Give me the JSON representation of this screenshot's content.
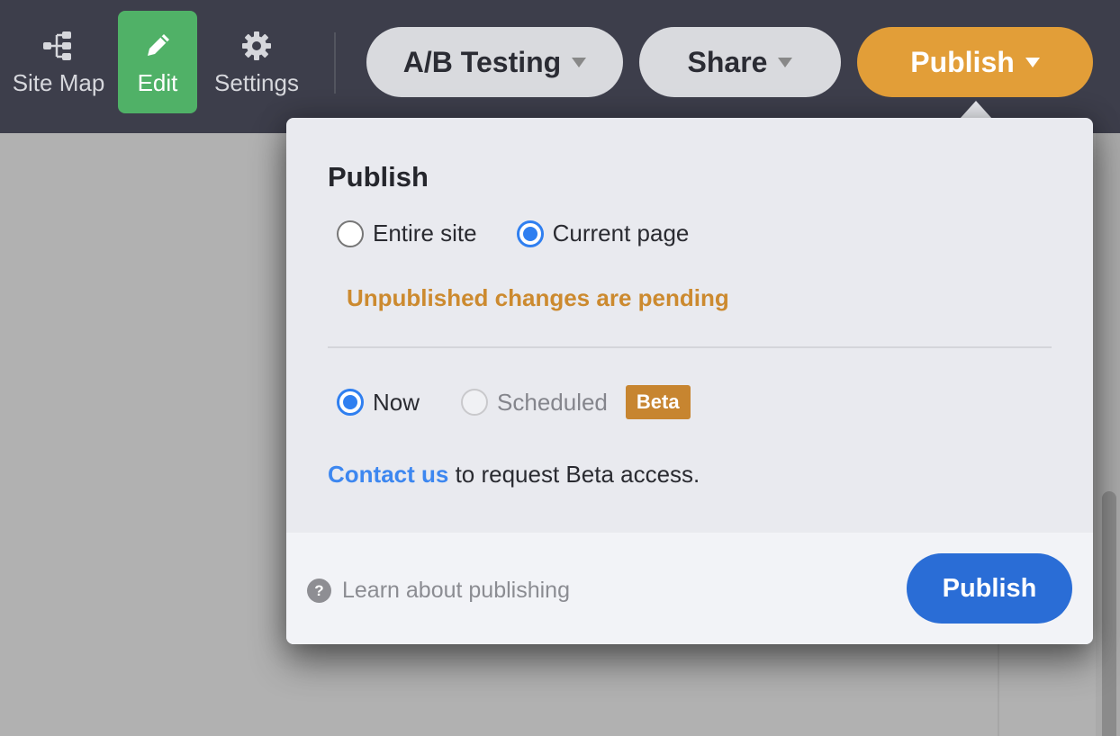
{
  "toolbar": {
    "tools": [
      {
        "label": "Site Map",
        "icon": "sitemap-icon"
      },
      {
        "label": "Edit",
        "icon": "pencil-icon",
        "active": true
      },
      {
        "label": "Settings",
        "icon": "gear-icon"
      }
    ],
    "buttons": {
      "ab_testing": "A/B Testing",
      "share": "Share",
      "publish": "Publish"
    }
  },
  "publish_popover": {
    "title": "Publish",
    "scope_options": [
      {
        "label": "Entire site",
        "checked": false
      },
      {
        "label": "Current page",
        "checked": true
      }
    ],
    "status_message": "Unpublished changes are pending",
    "timing_options": [
      {
        "label": "Now",
        "checked": true,
        "disabled": false
      },
      {
        "label": "Scheduled",
        "checked": false,
        "disabled": true
      }
    ],
    "beta_badge": "Beta",
    "contact_link": "Contact us",
    "contact_text": " to request Beta access.",
    "learn_link": "Learn about publishing",
    "publish_button": "Publish"
  },
  "colors": {
    "topbar": "#3d3e4b",
    "edit_active": "#50b167",
    "publish_accent": "#e29e38",
    "pending_text": "#cc8a2f",
    "beta_badge": "#c78530",
    "link": "#3d87f0",
    "primary_button": "#2a6dd6"
  }
}
